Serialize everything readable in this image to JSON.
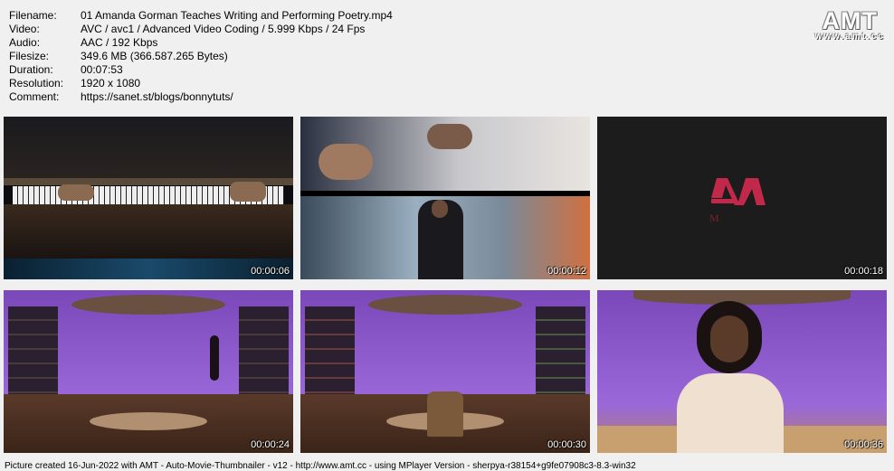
{
  "info": {
    "rows": [
      {
        "key": "Filename:",
        "value": "01 Amanda Gorman Teaches Writing and Performing Poetry.mp4"
      },
      {
        "key": "Video:",
        "value": "AVC / avc1 / Advanced Video Coding / 5.999 Kbps / 24 Fps"
      },
      {
        "key": "Audio:",
        "value": "AAC / 192 Kbps"
      },
      {
        "key": "Filesize:",
        "value": "349.6 MB (366.587.265 Bytes)"
      },
      {
        "key": "Duration:",
        "value": "00:07:53"
      },
      {
        "key": "Resolution:",
        "value": "1920 x 1080"
      },
      {
        "key": "Comment:",
        "value": "https://sanet.st/blogs/bonnytuts/"
      }
    ]
  },
  "logo": {
    "big": "AMT",
    "small": "www.amt.cc"
  },
  "thumbnails": [
    {
      "time": "00:00:06",
      "icon": "piano-scene"
    },
    {
      "time": "00:00:12",
      "icon": "studio-collage"
    },
    {
      "time": "00:00:18",
      "icon": "masterclass-logo"
    },
    {
      "time": "00:00:24",
      "icon": "purple-set-silhouette"
    },
    {
      "time": "00:00:30",
      "icon": "purple-set-chair"
    },
    {
      "time": "00:00:36",
      "icon": "presenter"
    }
  ],
  "footer": "Picture created 16-Jun-2022 with AMT - Auto-Movie-Thumbnailer - v12 - http://www.amt.cc - using MPlayer Version - sherpya-r38154+g9fe07908c3-8.3-win32",
  "colors": {
    "background": "#f0f0f0",
    "purple": "#8a58c8",
    "brand": "#c2284a"
  }
}
